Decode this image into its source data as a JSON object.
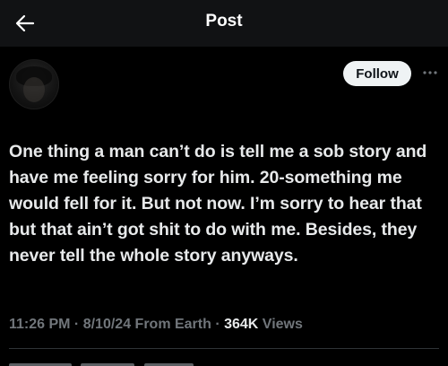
{
  "header": {
    "back_icon": "arrow-left-icon",
    "title": "Post"
  },
  "author": {
    "avatar": "profile-photo",
    "follow_label": "Follow",
    "more_icon": "more-horizontal-icon"
  },
  "post": {
    "text": "One thing a man can’t do is tell me a sob story and have me feeling sorry for him. 20-something me would fell for it. But not now. I’m sorry to hear that but that ain’t got shit to do with me. Besides, they never tell the whole story anyways."
  },
  "meta": {
    "time": "11:26 PM",
    "sep1": " · ",
    "date": "8/10/24",
    "location": " From Earth",
    "sep2": " · ",
    "views_count": "364K",
    "views_label": " Views"
  },
  "colors": {
    "background": "#000000",
    "header_background": "#111214",
    "text": "#e7e9ea",
    "secondary_text": "#71767b",
    "follow_button_bg": "#eff3f4",
    "divider": "#2f3336"
  }
}
